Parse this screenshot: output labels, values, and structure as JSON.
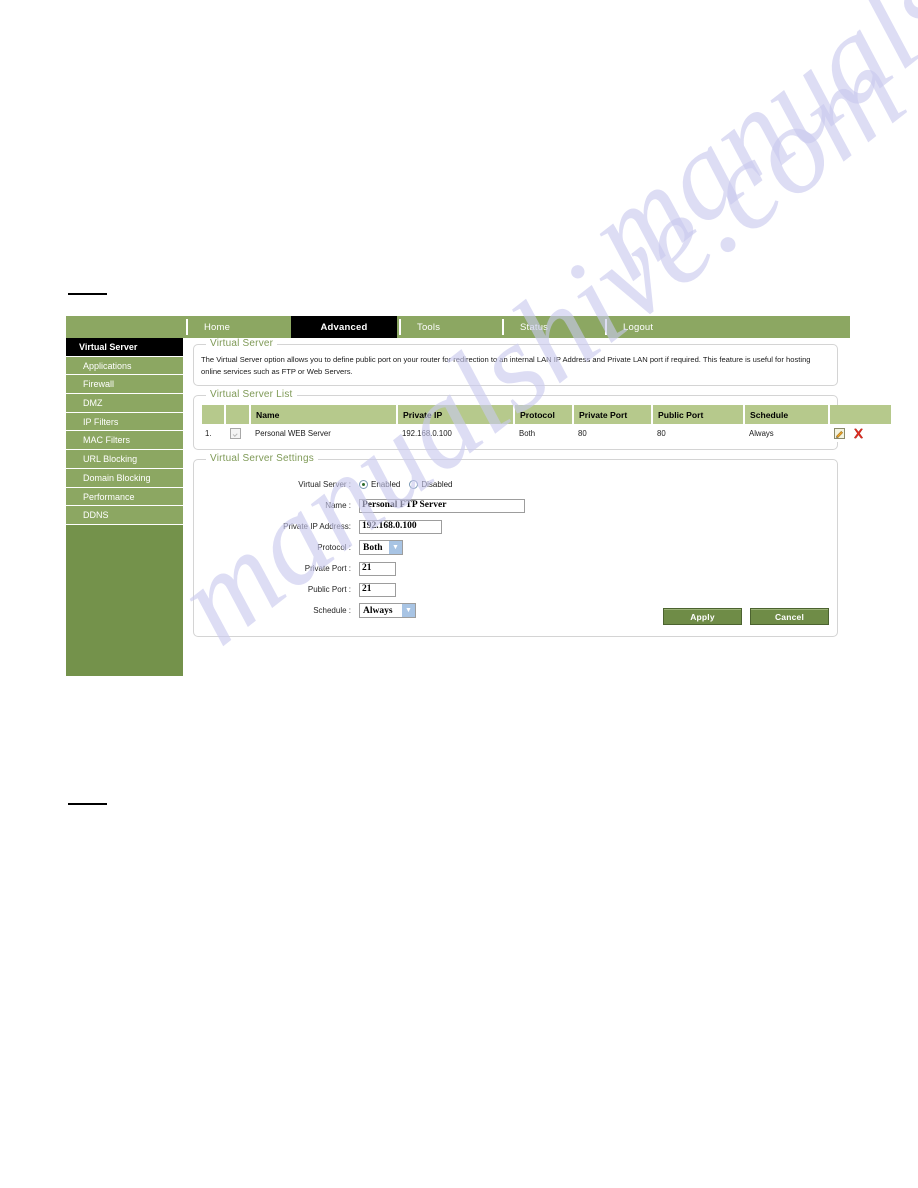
{
  "watermark": {
    "text": "manualshive.com"
  },
  "nav": {
    "tabs": [
      {
        "label": "Home",
        "active": false
      },
      {
        "label": "Advanced",
        "active": true
      },
      {
        "label": "Tools",
        "active": false
      },
      {
        "label": "Status",
        "active": false
      },
      {
        "label": "Logout",
        "active": false
      }
    ]
  },
  "sidebar": {
    "items": [
      {
        "label": "Virtual Server",
        "active": true
      },
      {
        "label": "Applications",
        "active": false
      },
      {
        "label": "Firewall",
        "active": false
      },
      {
        "label": "DMZ",
        "active": false
      },
      {
        "label": "IP Filters",
        "active": false
      },
      {
        "label": "MAC Filters",
        "active": false
      },
      {
        "label": "URL Blocking",
        "active": false
      },
      {
        "label": "Domain Blocking",
        "active": false
      },
      {
        "label": "Performance",
        "active": false
      },
      {
        "label": "DDNS",
        "active": false
      }
    ]
  },
  "description_panel": {
    "title": "Virtual Server",
    "text": "The Virtual Server option allows you to define public port on your router for redirection to an internal LAN IP Address and Private LAN port if required. This feature is useful for hosting online services such as FTP or Web Servers."
  },
  "list_panel": {
    "title": "Virtual Server List",
    "columns": [
      "",
      "",
      "Name",
      "Private IP",
      "Protocol",
      "Private Port",
      "Public Port",
      "Schedule",
      ""
    ],
    "rows": [
      {
        "index": "1.",
        "checked": true,
        "name": "Personal WEB Server",
        "private_ip": "192.168.0.100",
        "protocol": "Both",
        "private_port": "80",
        "public_port": "80",
        "schedule": "Always",
        "edit_icon": "edit-icon",
        "delete_icon": "delete-icon"
      }
    ]
  },
  "settings_panel": {
    "title": "Virtual Server Settings",
    "virtual_server": {
      "label": "Virtual Server :",
      "enabled_label": "Enabled",
      "disabled_label": "Disabled",
      "selected": "Enabled"
    },
    "name": {
      "label": "Name :",
      "value": "Personal FTP Server"
    },
    "private_ip": {
      "label": "Private IP Address:",
      "value": "192.168.0.100"
    },
    "protocol": {
      "label": "Protocol :",
      "value": "Both"
    },
    "private_port": {
      "label": "Private Port :",
      "value": "21"
    },
    "public_port": {
      "label": "Public Port :",
      "value": "21"
    },
    "schedule": {
      "label": "Schedule :",
      "value": "Always"
    },
    "buttons": {
      "apply": "Apply",
      "cancel": "Cancel"
    }
  }
}
